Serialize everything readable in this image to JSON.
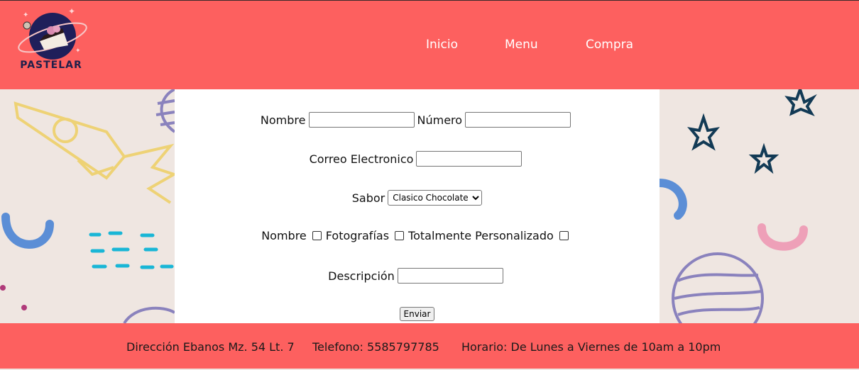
{
  "brand": {
    "name": "PASTELAR"
  },
  "nav": {
    "items": [
      "Inicio",
      "Menu",
      "Compra"
    ]
  },
  "form": {
    "nombre_label": "Nombre",
    "numero_label": "Número",
    "correo_label": "Correo Electronico",
    "sabor_label": "Sabor",
    "sabor_selected": "Clasico Chocolate",
    "options": [
      "Nombre",
      "Fotografías",
      "Totalmente Personalizado"
    ],
    "descripcion_label": "Descripción",
    "submit_label": "Enviar"
  },
  "footer": {
    "direccion": "Dirección Ebanos Mz. 54 Lt. 7",
    "telefono": "Telefono: 5585797785",
    "horario": "Horario: De Lunes a Viernes de 10am a 10pm"
  },
  "colors": {
    "header_bg": "#fd605f",
    "page_bg": "#efe6e1",
    "panel_bg": "#ffffff"
  },
  "icons": [
    "logo-planet-icon",
    "rocket-icon",
    "star-icon",
    "planet-icon",
    "arc-icon"
  ]
}
